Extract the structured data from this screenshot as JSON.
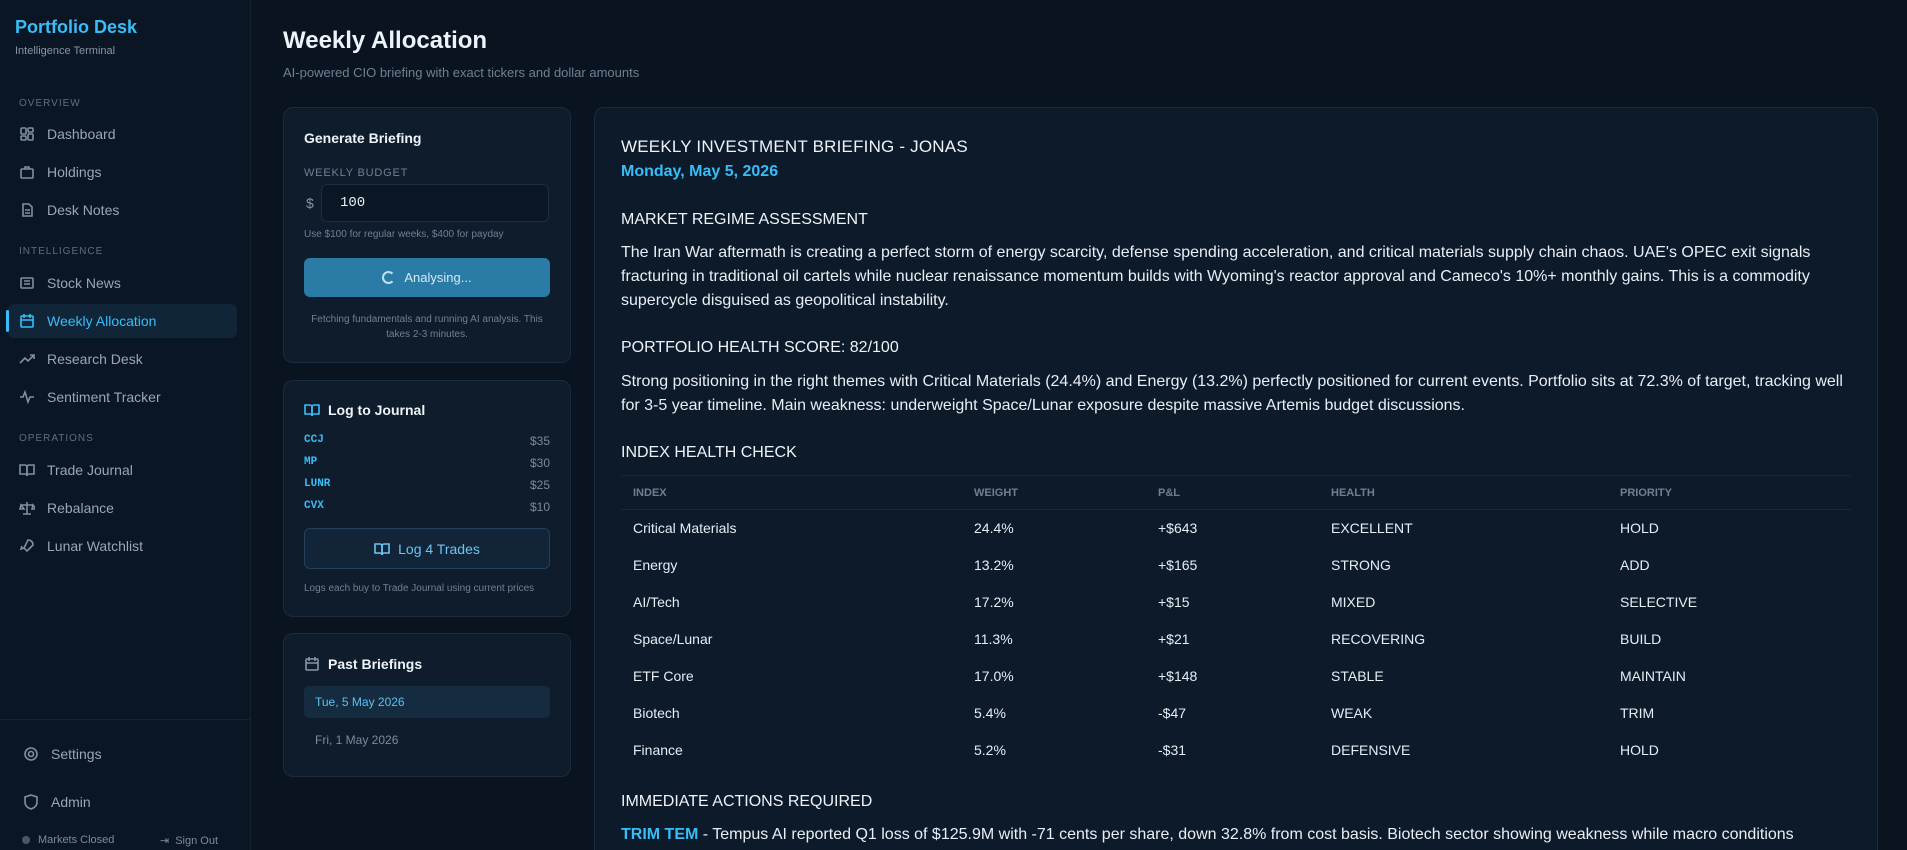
{
  "brand": {
    "title": "Portfolio Desk",
    "subtitle": "Intelligence Terminal"
  },
  "sidebar": {
    "sections": [
      "OVERVIEW",
      "INTELLIGENCE",
      "OPERATIONS"
    ],
    "items": [
      {
        "label": "Dashboard",
        "icon": "dashboard-icon"
      },
      {
        "label": "Holdings",
        "icon": "briefcase-icon"
      },
      {
        "label": "Desk Notes",
        "icon": "document-icon"
      },
      {
        "label": "Stock News",
        "icon": "newspaper-icon"
      },
      {
        "label": "Weekly Allocation",
        "icon": "calendar-icon",
        "active": true
      },
      {
        "label": "Research Desk",
        "icon": "trending-icon"
      },
      {
        "label": "Sentiment Tracker",
        "icon": "pulse-icon"
      },
      {
        "label": "Trade Journal",
        "icon": "book-icon"
      },
      {
        "label": "Rebalance",
        "icon": "scale-icon"
      },
      {
        "label": "Lunar Watchlist",
        "icon": "rocket-icon"
      }
    ],
    "bottom_items": [
      {
        "label": "Settings",
        "icon": "gear-icon"
      },
      {
        "label": "Admin",
        "icon": "shield-icon"
      }
    ],
    "market_status": "Markets Closed",
    "sign_out": "Sign Out"
  },
  "header": {
    "title": "Weekly Allocation",
    "subtitle": "AI-powered CIO briefing with exact tickers and dollar amounts"
  },
  "generate": {
    "title": "Generate Briefing",
    "budget_label": "WEEKLY BUDGET",
    "currency": "$",
    "budget_value": "100",
    "hint": "Use $100 for regular weeks, $400 for payday",
    "button_label": "Analysing...",
    "note": "Fetching fundamentals and running AI analysis. This takes 2-3 minutes."
  },
  "journal": {
    "title": "Log to Journal",
    "trades": [
      {
        "ticker": "CCJ",
        "amount": "$35"
      },
      {
        "ticker": "MP",
        "amount": "$30"
      },
      {
        "ticker": "LUNR",
        "amount": "$25"
      },
      {
        "ticker": "CVX",
        "amount": "$10"
      }
    ],
    "button_label": "Log 4 Trades",
    "note": "Logs each buy to Trade Journal using current prices"
  },
  "past": {
    "title": "Past Briefings",
    "items": [
      "Tue, 5 May 2026",
      "Fri, 1 May 2026"
    ]
  },
  "report": {
    "title": "WEEKLY INVESTMENT BRIEFING - JONAS",
    "date": "Monday, May 5, 2026",
    "regime_heading": "MARKET REGIME ASSESSMENT",
    "regime_text": "The Iran War aftermath is creating a perfect storm of energy scarcity, defense spending acceleration, and critical materials supply chain chaos. UAE's OPEC exit signals fracturing in traditional oil cartels while nuclear renaissance momentum builds with Wyoming's reactor approval and Cameco's 10%+ monthly gains. This is a commodity supercycle disguised as geopolitical instability.",
    "health_heading": "PORTFOLIO HEALTH SCORE: 82/100",
    "health_text": "Strong positioning in the right themes with Critical Materials (24.4%) and Energy (13.2%) perfectly positioned for current events. Portfolio sits at 72.3% of target, tracking well for 3-5 year timeline. Main weakness: underweight Space/Lunar exposure despite massive Artemis budget discussions.",
    "index_heading": "INDEX HEALTH CHECK",
    "columns": [
      "INDEX",
      "WEIGHT",
      "P&L",
      "HEALTH",
      "PRIORITY"
    ],
    "rows": [
      [
        "Critical Materials",
        "24.4%",
        "+$643",
        "EXCELLENT",
        "HOLD"
      ],
      [
        "Energy",
        "13.2%",
        "+$165",
        "STRONG",
        "ADD"
      ],
      [
        "AI/Tech",
        "17.2%",
        "+$15",
        "MIXED",
        "SELECTIVE"
      ],
      [
        "Space/Lunar",
        "11.3%",
        "+$21",
        "RECOVERING",
        "BUILD"
      ],
      [
        "ETF Core",
        "17.0%",
        "+$148",
        "STABLE",
        "MAINTAIN"
      ],
      [
        "Biotech",
        "5.4%",
        "-$47",
        "WEAK",
        "TRIM"
      ],
      [
        "Finance",
        "5.2%",
        "-$31",
        "DEFENSIVE",
        "HOLD"
      ]
    ],
    "actions_heading": "IMMEDIATE ACTIONS REQUIRED",
    "action_ticker": "TRIM TEM",
    "action_text": " - Tempus AI reported Q1 loss of $125.9M with -71 cents per share, down 32.8% from cost basis. Biotech sector showing weakness while macro conditions"
  },
  "colors": {
    "accent": "#38bdf8",
    "background": "#0a1320",
    "panel": "#0f1c2c"
  }
}
